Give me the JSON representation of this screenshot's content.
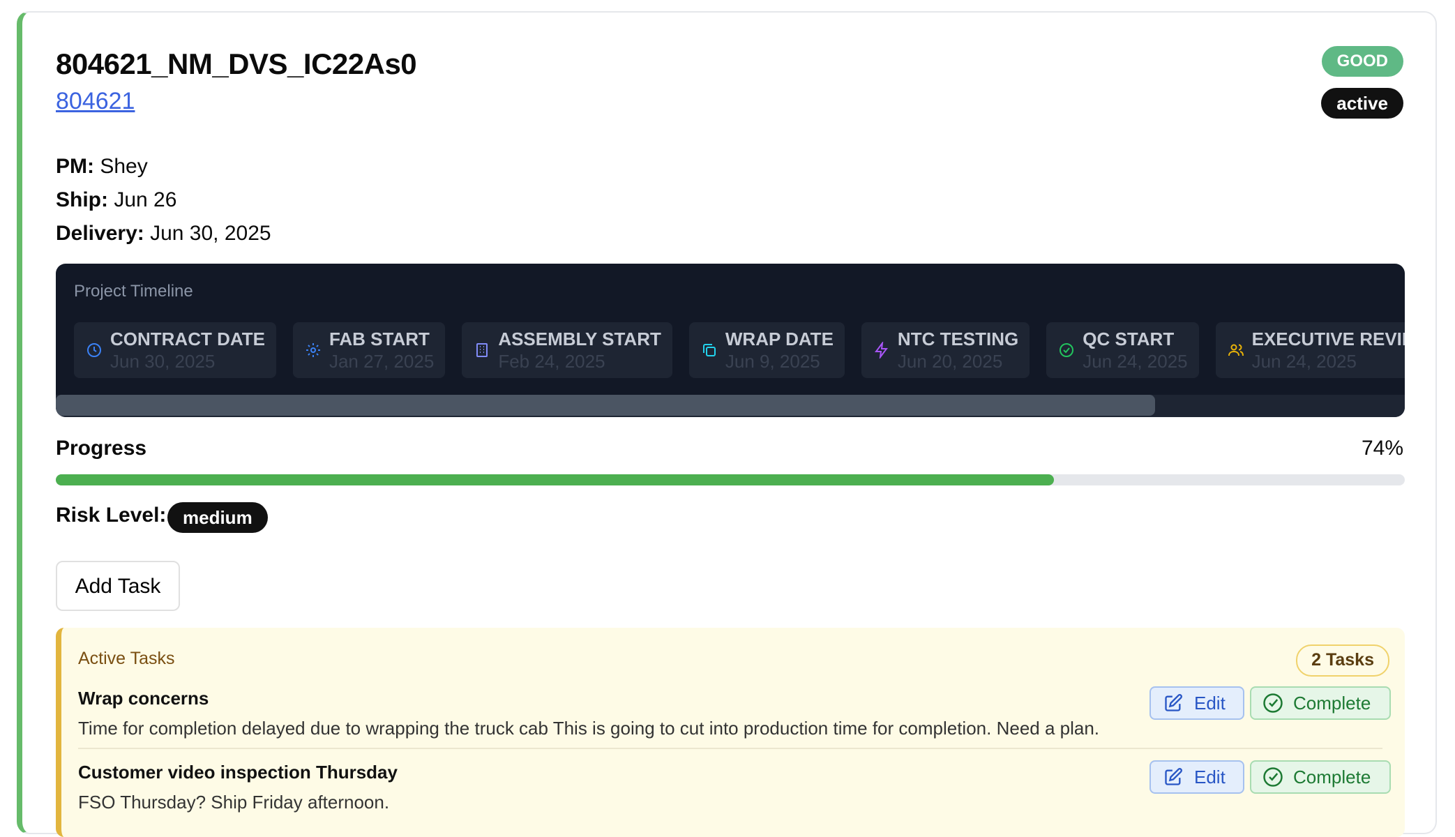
{
  "project": {
    "title": "804621_NM_DVS_IC22As0",
    "id_link": "804621",
    "health_badge": "GOOD",
    "status_badge": "active",
    "pm_label": "PM:",
    "pm_value": "Shey",
    "ship_label": "Ship:",
    "ship_value": "Jun 26",
    "delivery_label": "Delivery:",
    "delivery_value": "Jun 30, 2025"
  },
  "timeline": {
    "title": "Project Timeline",
    "items": [
      {
        "label": "CONTRACT DATE",
        "date": "Jun 30, 2025",
        "icon": "clock-icon",
        "color": "#3b82f6"
      },
      {
        "label": "FAB START",
        "date": "Jan 27, 2025",
        "icon": "gear-icon",
        "color": "#3b82f6"
      },
      {
        "label": "ASSEMBLY START",
        "date": "Feb 24, 2025",
        "icon": "building-icon",
        "color": "#818cf8"
      },
      {
        "label": "WRAP DATE",
        "date": "Jun 9, 2025",
        "icon": "copy-icon",
        "color": "#22d3ee"
      },
      {
        "label": "NTC TESTING",
        "date": "Jun 20, 2025",
        "icon": "bolt-icon",
        "color": "#a855f7"
      },
      {
        "label": "QC START",
        "date": "Jun 24, 2025",
        "icon": "check-circle-icon",
        "color": "#22c55e"
      },
      {
        "label": "EXECUTIVE REVIEW",
        "date": "Jun 24, 2025",
        "icon": "users-icon",
        "color": "#eab308"
      },
      {
        "label": "",
        "date": "",
        "icon": "map-pin-icon",
        "color": "#f97316"
      }
    ]
  },
  "progress": {
    "label": "Progress",
    "percent_text": "74%",
    "value": 0.74,
    "color": "#4caf50"
  },
  "risk": {
    "label": "Risk Level:",
    "value": "medium"
  },
  "actions": {
    "add_task": "Add Task"
  },
  "tasks": {
    "title": "Active Tasks",
    "count_label": "2 Tasks",
    "edit_label": "Edit",
    "complete_label": "Complete",
    "items": [
      {
        "title": "Wrap concerns",
        "description": "Time for completion delayed due to wrapping the truck cab This is going to cut into production time for completion. Need a plan."
      },
      {
        "title": "Customer video inspection Thursday",
        "description": "FSO Thursday? Ship Friday afternoon."
      }
    ]
  }
}
